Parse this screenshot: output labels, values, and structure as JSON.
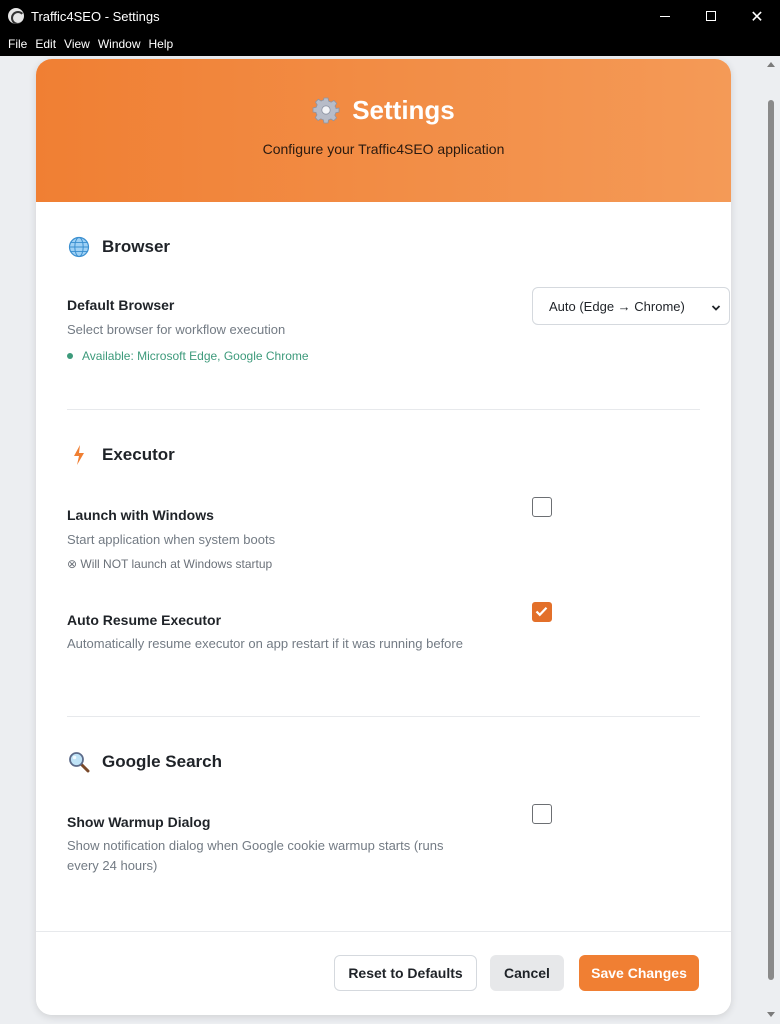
{
  "window": {
    "title": "Traffic4SEO - Settings",
    "controls": {
      "close": "✕"
    }
  },
  "menu": [
    "File",
    "Edit",
    "View",
    "Window",
    "Help"
  ],
  "header": {
    "title": "Settings",
    "subtitle": "Configure your Traffic4SEO application",
    "icon": "gear-icon",
    "gradient_start": "#f07f33",
    "gradient_end": "#f49a57"
  },
  "sections": {
    "browser": {
      "title": "Browser",
      "icon": "globe-icon",
      "default_browser": {
        "label": "Default Browser",
        "description": "Select browser for workflow execution",
        "status": "Available: Microsoft Edge, Google Chrome",
        "selected": "Auto (Edge → Chrome)"
      }
    },
    "executor": {
      "title": "Executor",
      "icon": "lightning-icon",
      "launch_with_windows": {
        "label": "Launch with Windows",
        "description": "Start application when system boots",
        "note": "⊗ Will NOT launch at Windows startup",
        "checked": false
      },
      "auto_resume": {
        "label": "Auto Resume Executor",
        "description": "Automatically resume executor on app restart if it was running before",
        "checked": true
      }
    },
    "google_search": {
      "title": "Google Search",
      "icon": "magnifier-icon",
      "warmup_dialog": {
        "label": "Show Warmup Dialog",
        "description": "Show notification dialog when Google cookie warmup starts (runs every 24 hours)",
        "checked": false
      }
    }
  },
  "footer": {
    "reset": "Reset to Defaults",
    "cancel": "Cancel",
    "save": "Save Changes"
  },
  "colors": {
    "accent": "#f07f33",
    "status_ok": "#3d9a7b"
  }
}
